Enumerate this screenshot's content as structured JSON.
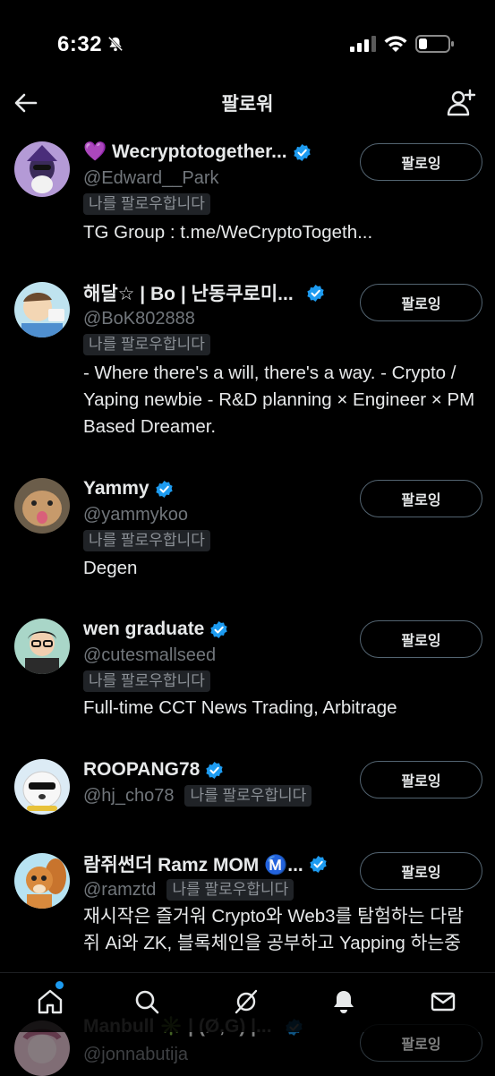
{
  "status_bar": {
    "time": "6:32"
  },
  "header": {
    "title": "팔로워"
  },
  "follows_you_label": "나를 팔로우합니다",
  "follow_button_label": "팔로잉",
  "users": [
    {
      "name": "💜 Wecryptotogether...",
      "handle": "@Edward__Park",
      "bio": "TG Group : t.me/WeCryptoTogeth..."
    },
    {
      "name": "해달☆ | Bo | 난동쿠로미...",
      "handle": "@BoK802888",
      "bio": "- Where there's a will, there's a way. - Crypto / Yaping newbie - R&D planning × Engineer × PM Based Dreamer."
    },
    {
      "name": "Yammy",
      "handle": "@yammykoo",
      "bio": "Degen"
    },
    {
      "name": "wen graduate",
      "handle": "@cutesmallseed",
      "bio": "Full-time CCT News Trading, Arbitrage"
    },
    {
      "name": "ROOPANG78",
      "handle": "@hj_cho78",
      "bio": ""
    },
    {
      "name": "람쥐썬더 Ramz MOM Ⓜ️...",
      "handle": "@ramztd",
      "bio": "재시작은 즐거워 Crypto와 Web3를 탐험하는 다람쥐 Ai와 ZK, 블록체인을 공부하고 Yapping 하는중"
    },
    {
      "name": "Manbull ✳️ | (Ø,G) |...",
      "handle": "@jonnabutija",
      "bio": ""
    }
  ],
  "colors": {
    "verified": "#1d9bf0",
    "background": "#000000",
    "muted": "#71767b"
  },
  "icons": {
    "back": "arrow-left-icon",
    "add_user": "add-user-icon",
    "nav": [
      "home-icon",
      "search-icon",
      "grok-icon",
      "notifications-icon",
      "messages-icon"
    ]
  }
}
